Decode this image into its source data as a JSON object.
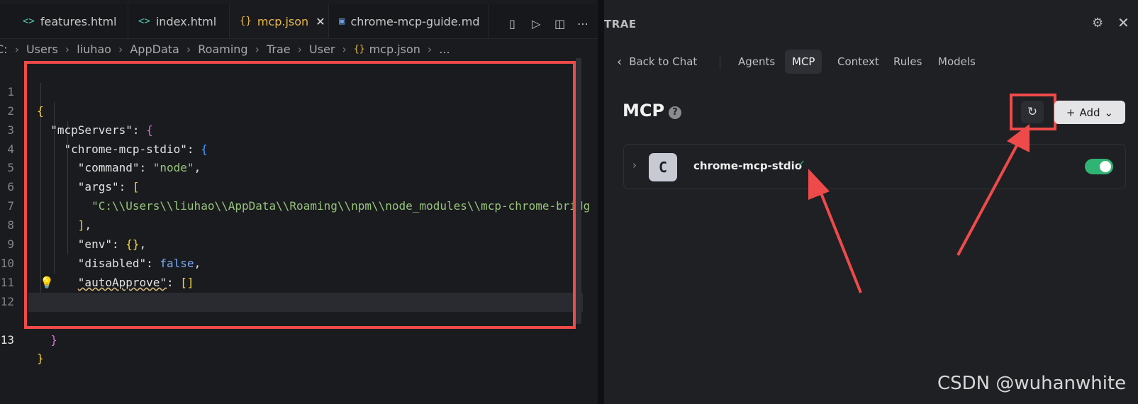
{
  "editor": {
    "tabs": [
      {
        "label": "features.html",
        "icon": "code-icon"
      },
      {
        "label": "index.html",
        "icon": "code-icon"
      },
      {
        "label": "mcp.json",
        "icon": "json-braces-icon",
        "active": true
      },
      {
        "label": "chrome-mcp-guide.md",
        "icon": "markdown-icon"
      }
    ],
    "breadcrumb": [
      "C:",
      "Users",
      "liuhao",
      "AppData",
      "Roaming",
      "Trae",
      "User",
      "mcp.json",
      "..."
    ],
    "line_numbers": [
      "1",
      "2",
      "3",
      "4",
      "5",
      "6",
      "7",
      "8",
      "9",
      "10",
      "11",
      "12",
      "13"
    ],
    "code": {
      "l1_open": "{",
      "l2_key": "\"mcpServers\"",
      "l2_colon": ": ",
      "l2_brace": "{",
      "l3_key": "\"chrome-mcp-stdio\"",
      "l3_colon": ": ",
      "l3_brace": "{",
      "l4_key": "\"command\"",
      "l4_colon": ": ",
      "l4_val": "\"node\"",
      "l4_comma": ",",
      "l5_key": "\"args\"",
      "l5_colon": ": ",
      "l5_brack": "[",
      "l6_val": "\"C:\\\\Users\\\\liuhao\\\\AppData\\\\Roaming\\\\npm\\\\node_modules\\\\mcp-chrome-bridg",
      "l7_brack": "]",
      "l7_comma": ",",
      "l8_key": "\"env\"",
      "l8_colon": ": ",
      "l8_val": "{}",
      "l8_comma": ",",
      "l9_key": "\"disabled\"",
      "l9_colon": ": ",
      "l9_val": "false",
      "l9_comma": ",",
      "l10_key": "\"autoApprove\"",
      "l10_colon": ": ",
      "l10_val": "[]",
      "l11_close": "}",
      "l12_close": "}",
      "l13_close": "}"
    }
  },
  "panel": {
    "title": "TRAE",
    "back_label": "Back to Chat",
    "tabs": [
      "Agents",
      "MCP",
      "Context",
      "Rules",
      "Models"
    ],
    "active_tab": "MCP",
    "heading": "MCP",
    "help": "?",
    "add_label": "Add",
    "server": {
      "avatar_letter": "C",
      "name": "chrome-mcp-stdio",
      "status": "✓",
      "enabled": true
    }
  },
  "watermark": "CSDN @wuhanwhite",
  "colors": {
    "annotation_red": "#ef4a4a",
    "toggle_green": "#2fb573",
    "json_key": "#e2e2e2",
    "json_string": "#98c379"
  }
}
